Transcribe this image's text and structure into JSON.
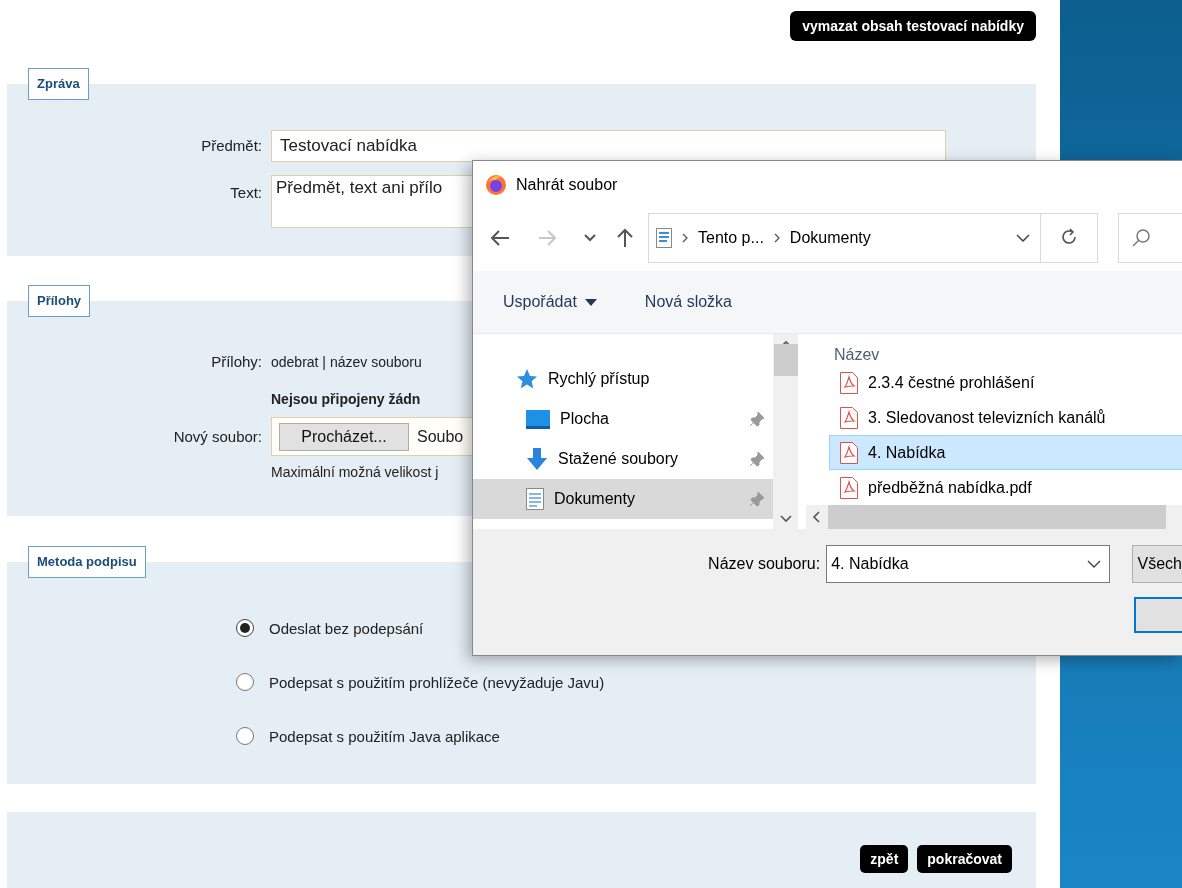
{
  "clear_button": "vymazat obsah testovací nabídky",
  "message": {
    "legend": "Zpráva",
    "subject_label": "Předmět:",
    "subject_value": "Testovací nabídka",
    "text_label": "Text:",
    "text_value": "Předmět, text ani přílo"
  },
  "attachments": {
    "legend": "Přílohy",
    "list_label": "Přílohy:",
    "list_header": "odebrat | název souboru",
    "empty_text": "Nejsou připojeny žádn",
    "new_file_label": "Nový soubor:",
    "browse_button": "Procházet...",
    "file_status": "Soubo",
    "size_note": "Maximální možná velikost j"
  },
  "signature": {
    "legend": "Metoda podpisu",
    "options": [
      {
        "label": "Odeslat bez podepsání",
        "selected": true
      },
      {
        "label": "Podepsat s použitím prohlížeče (nevyžaduje Javu)",
        "selected": false
      },
      {
        "label": "Podepsat s použitím Java aplikace",
        "selected": false
      }
    ]
  },
  "footer_buttons": [
    "zpět",
    "pokračovat"
  ],
  "dialog": {
    "title": "Nahrát soubor",
    "nav_buttons": [
      {
        "kind": "back",
        "disabled": false
      },
      {
        "kind": "forward",
        "disabled": true
      },
      {
        "kind": "history",
        "disabled": false
      },
      {
        "kind": "up",
        "disabled": false
      }
    ],
    "breadcrumb": [
      "Tento p...",
      "Dokumenty"
    ],
    "toolbar": [
      {
        "label": "Uspořádat",
        "kind": "menu"
      },
      {
        "label": "Nová složka",
        "kind": "button"
      }
    ],
    "nav_items": [
      {
        "label": "Rychlý přístup",
        "kind": "star",
        "pinned": false,
        "selected": false
      },
      {
        "label": "Plocha",
        "kind": "desktop",
        "pinned": true,
        "selected": false
      },
      {
        "label": "Stažené soubory",
        "kind": "download",
        "pinned": true,
        "selected": false
      },
      {
        "label": "Dokumenty",
        "kind": "documents",
        "pinned": true,
        "selected": true
      }
    ],
    "column_header": "Název",
    "files": [
      {
        "name": "2.3.4 čestné prohlášení",
        "selected": false
      },
      {
        "name": "3. Sledovanost televizních kanálů",
        "selected": false
      },
      {
        "name": "4. Nabídka",
        "selected": true
      },
      {
        "name": "předběžná nabídka.pdf",
        "selected": false
      }
    ],
    "filename_label": "Název souboru:",
    "filename_value": "4. Nabídka",
    "filter_button": "Všech"
  }
}
